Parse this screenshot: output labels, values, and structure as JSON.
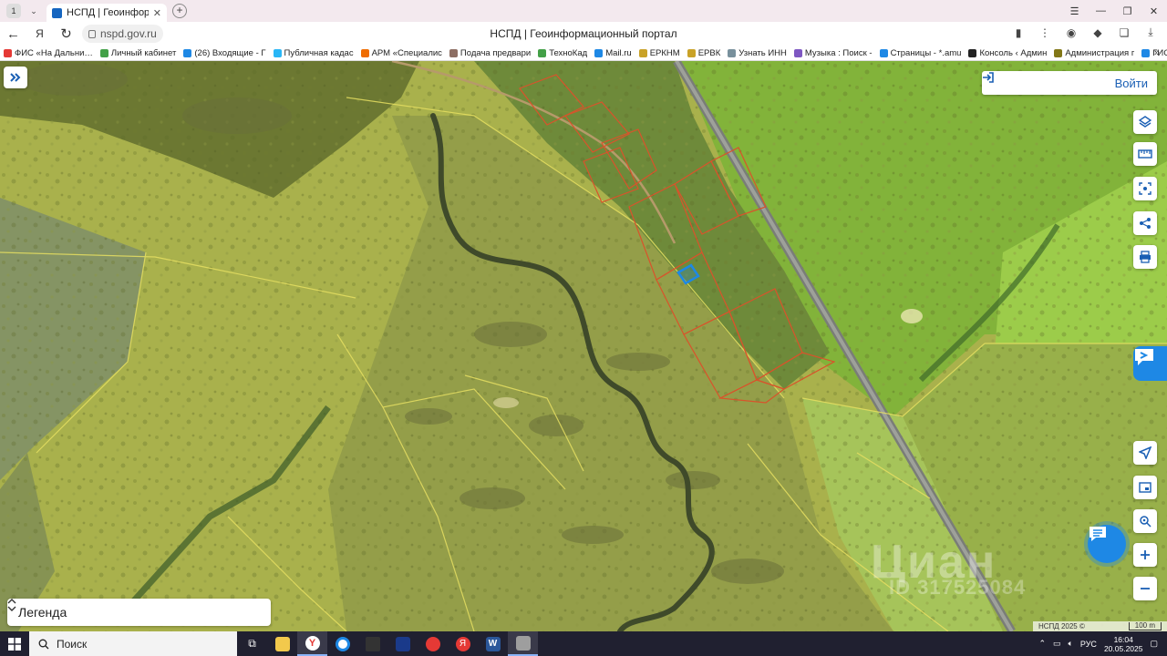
{
  "browser": {
    "tab_counter": "1",
    "tab_title": "НСПД | Геоинформационный портал",
    "url": "nspd.gov.ru",
    "page_title": "НСПД | Геоинформационный портал"
  },
  "bookmarks": [
    {
      "label": "ФИС «На Дальни…",
      "color": "#e53935"
    },
    {
      "label": "Личный кабинет",
      "color": "#43a047"
    },
    {
      "label": "(26) Входящие - Г",
      "color": "#1e88e5"
    },
    {
      "label": "Публичная кадас",
      "color": "#29b6f6"
    },
    {
      "label": "АРМ «Специалис",
      "color": "#ef6c00"
    },
    {
      "label": "Подача предвари",
      "color": "#8d6e63"
    },
    {
      "label": "ТехноКад",
      "color": "#43a047"
    },
    {
      "label": "Mail.ru",
      "color": "#1e88e5"
    },
    {
      "label": "ЕРКНМ",
      "color": "#c9a227"
    },
    {
      "label": "ЕРВК",
      "color": "#c9a227"
    },
    {
      "label": "Узнать ИНН",
      "color": "#78909c"
    },
    {
      "label": "Музыка : Поиск -",
      "color": "#7e57c2"
    },
    {
      "label": "Страницы - *.amu",
      "color": "#1e88e5"
    },
    {
      "label": "Консоль ‹ Админ",
      "color": "#222222"
    },
    {
      "label": "Администрация г",
      "color": "#827717"
    },
    {
      "label": "ГИС",
      "color": "#1e88e5"
    }
  ],
  "map": {
    "login_label": "Войти",
    "legend_label": "Легенда",
    "copyright": "НСПД 2025 ©",
    "scale_label": "100 m",
    "watermark": "Циан",
    "watermark_id": "ID 317525084",
    "accent_color": "#1e88e5",
    "parcel_color": "#d9532b"
  },
  "map_tools": [
    {
      "name": "layers-icon"
    },
    {
      "name": "ruler-icon"
    },
    {
      "name": "select-area-icon"
    },
    {
      "name": "share-icon"
    },
    {
      "name": "print-icon"
    }
  ],
  "taskbar": {
    "search_placeholder": "Поиск",
    "lang": "РУС",
    "time": "16:04",
    "date": "20.05.2025"
  }
}
